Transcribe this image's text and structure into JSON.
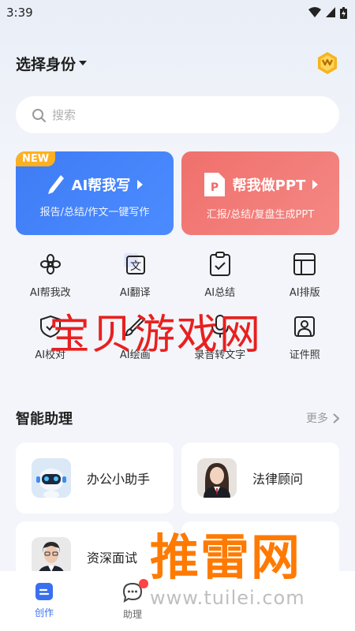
{
  "status_bar": {
    "time": "3:39"
  },
  "header": {
    "identity_label": "选择身份"
  },
  "search": {
    "placeholder": "搜索"
  },
  "cards": [
    {
      "tag": "NEW",
      "title": "AI帮我写",
      "subtitle": "报告/总结/作文一键写作",
      "color": "#4282f6"
    },
    {
      "title": "帮我做PPT",
      "subtitle": "汇报/总结/复盘生成PPT",
      "color": "#f27a76"
    }
  ],
  "tools": [
    {
      "label": "AI帮我改",
      "icon": "flower-icon"
    },
    {
      "label": "AI翻译",
      "icon": "translate-icon"
    },
    {
      "label": "AI总结",
      "icon": "clipboard-check-icon"
    },
    {
      "label": "AI排版",
      "icon": "layout-icon"
    },
    {
      "label": "AI校对",
      "icon": "shield-check-icon"
    },
    {
      "label": "AI绘画",
      "icon": "brush-icon"
    },
    {
      "label": "录音转文字",
      "icon": "microphone-icon"
    },
    {
      "label": "证件照",
      "icon": "id-photo-icon"
    }
  ],
  "section": {
    "title": "智能助理",
    "more_label": "更多"
  },
  "assistants": [
    {
      "name": "办公小助手"
    },
    {
      "name": "法律顾问"
    },
    {
      "name": "资深面试"
    },
    {
      "name": ""
    }
  ],
  "bottom_nav": [
    {
      "label": "创作",
      "active": true
    },
    {
      "label": "助理",
      "active": false
    }
  ],
  "watermarks": {
    "site_name": "宝贝游戏网",
    "brand": "推雷网",
    "url": "www.tuilei.com"
  }
}
